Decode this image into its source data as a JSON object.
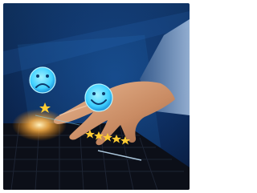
{
  "photo": {
    "subject": "hand-on-laptop-with-rating-overlay",
    "icons": [
      "sad-face-icon",
      "happy-face-icon"
    ],
    "ratings": [
      {
        "face": "sad",
        "stars": 1
      },
      {
        "face": "happy",
        "stars": 5
      }
    ],
    "colors": {
      "background": "#0a2450",
      "hologram": "#3fd0ff",
      "star": "#ffcc33",
      "glow": "#ffb347",
      "keyboard": "#0c0f18",
      "skin": "#d9a27c"
    }
  }
}
